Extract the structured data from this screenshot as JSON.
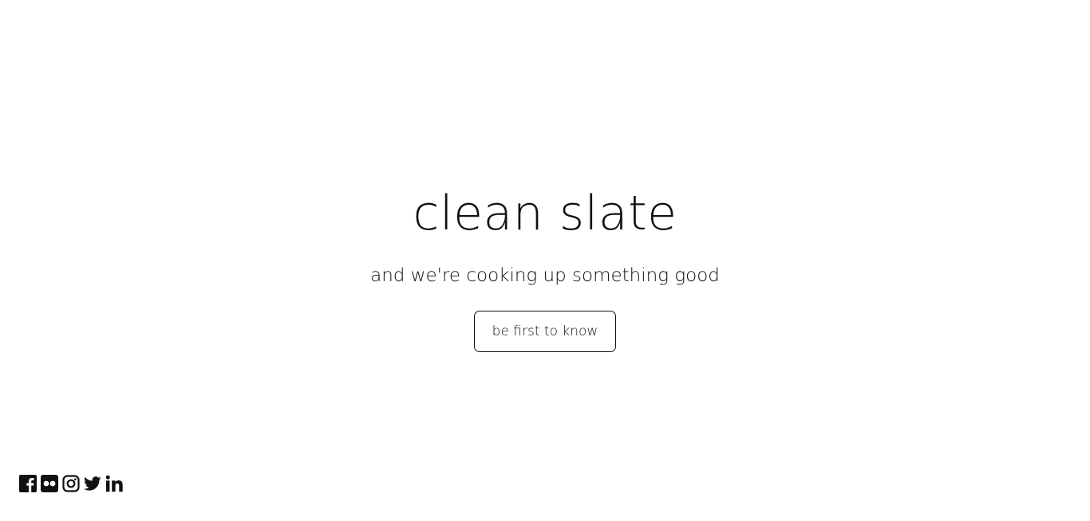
{
  "hero": {
    "title": "clean slate",
    "subtitle": "and we're cooking up something good",
    "cta_label": "be first to know"
  },
  "social": {
    "icons": [
      "facebook-icon",
      "flickr-icon",
      "instagram-icon",
      "twitter-icon",
      "linkedin-icon"
    ]
  },
  "colors": {
    "background": "#ffffff",
    "text": "#111111"
  }
}
